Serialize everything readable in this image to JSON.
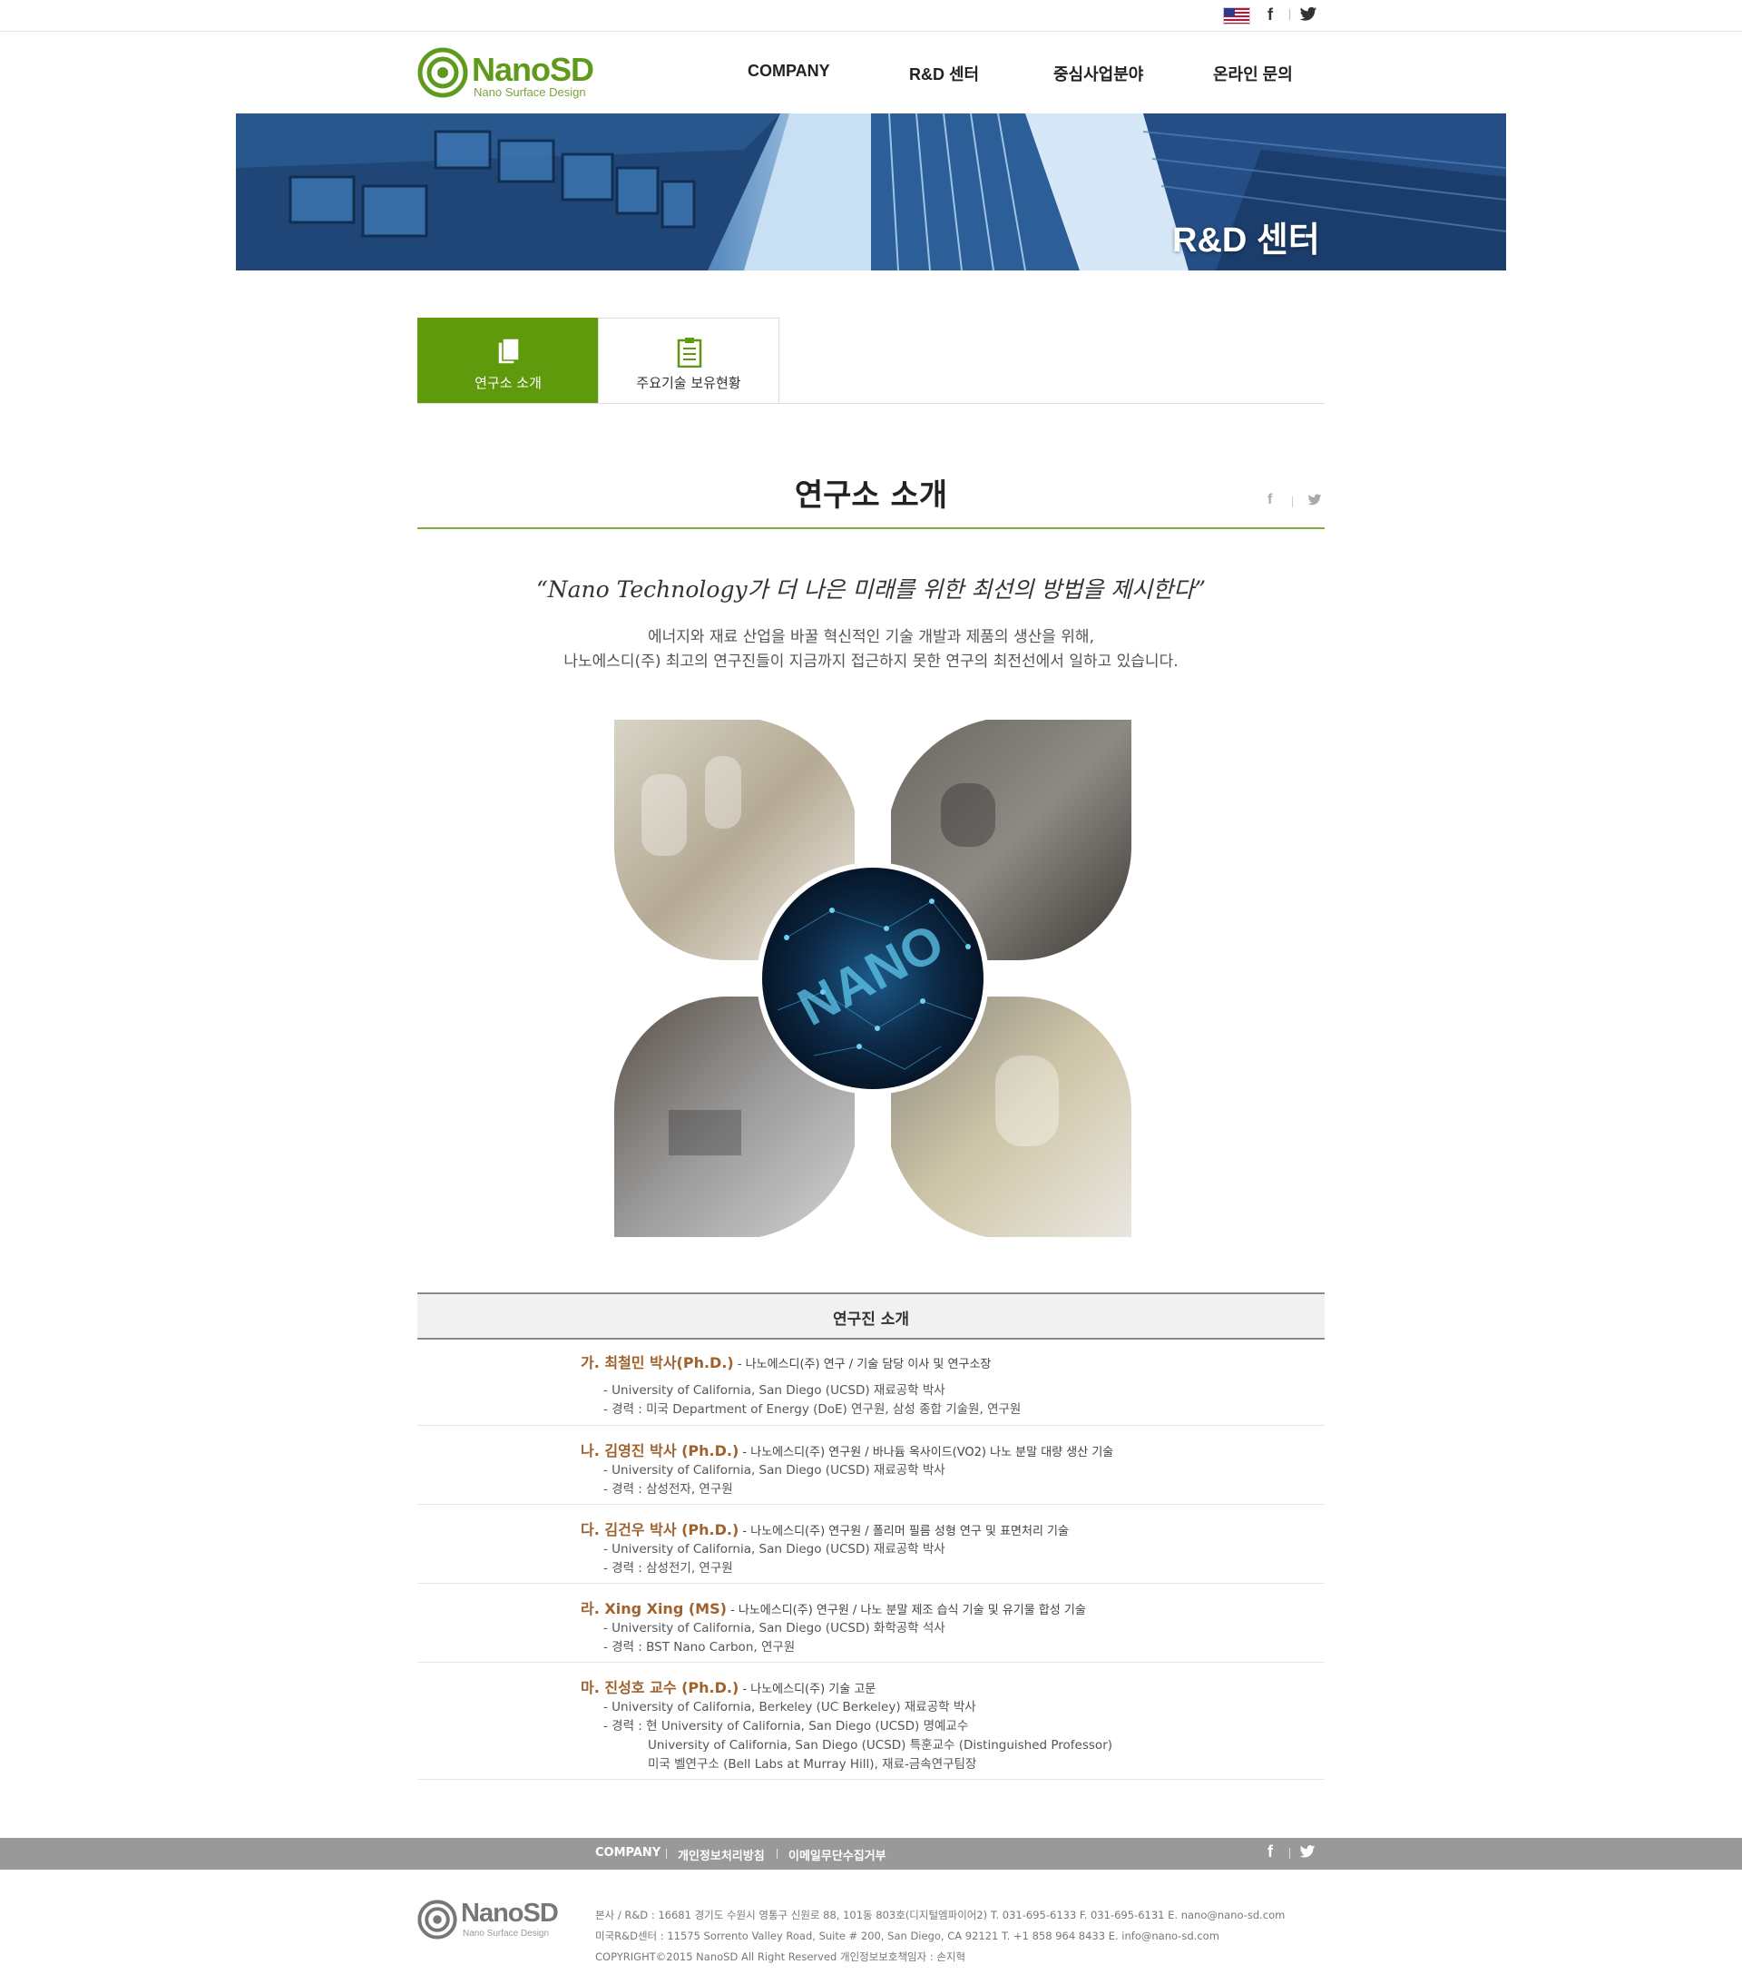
{
  "topbar": {
    "lang_icon": "us-flag-icon",
    "social": [
      "facebook-icon",
      "twitter-icon"
    ],
    "facebook_glyph": "f"
  },
  "header": {
    "logo_name": "NanoSD",
    "logo_sub": "Nano Surface Design",
    "nav": [
      "COMPANY",
      "R&D 센터",
      "중심사업분야",
      "온라인 문의"
    ]
  },
  "hero": {
    "title": "R&D 센터"
  },
  "tabs": [
    {
      "label": "연구소 소개",
      "icon": "documents-icon",
      "active": true
    },
    {
      "label": "주요기술 보유현황",
      "icon": "clipboard-icon",
      "active": false
    }
  ],
  "section": {
    "title": "연구소 소개",
    "share_facebook": "f",
    "quote": "“Nano Technology가 더 나은 미래를 위한 최선의 방법을 제시한다”",
    "intro": [
      "에너지와 재료 산업을 바꿀 혁신적인 기술 개발과 제품의 생산을 위해,",
      "나노에스디(주) 최고의 연구진들이 지금까지 접근하지 못한 연구의 최전선에서 일하고 있습니다."
    ],
    "clover_text": "NANO",
    "colors": {
      "accent": "#5f9a0c",
      "accent_line": "#7fb03a",
      "name": "#a0622d",
      "footer_bar": "#999999"
    }
  },
  "researchers": {
    "heading": "연구진 소개",
    "people": [
      {
        "name": "가. 최철민 박사(Ph.D.)",
        "role": " - 나노에스디(주) 연구 / 기술 담당 이사 및 연구소장",
        "lines": [
          {
            "text": "- University of California, San Diego (UCSD) 재료공학 박사",
            "indent": false
          },
          {
            "text": "- 경력 : 미국 Department of Energy (DoE) 연구원, 삼성 종합 기술원, 연구원",
            "indent": false
          }
        ]
      },
      {
        "name": "나. 김영진 박사 (Ph.D.)",
        "role": " - 나노에스디(주) 연구원 / 바나듐 옥사이드(VO2) 나노 분말 대량 생산 기술",
        "lines": [
          {
            "text": "- University of California, San Diego (UCSD) 재료공학 박사",
            "indent": false
          },
          {
            "text": "- 경력 : 삼성전자, 연구원",
            "indent": false
          }
        ]
      },
      {
        "name": "다. 김건우 박사 (Ph.D.)",
        "role": " - 나노에스디(주) 연구원 / 폴리머 필름 성형 연구 및 표면처리 기술",
        "lines": [
          {
            "text": "- University of California, San Diego (UCSD) 재료공학 박사",
            "indent": false
          },
          {
            "text": "- 경력 : 삼성전기, 연구원",
            "indent": false
          }
        ]
      },
      {
        "name": "라. Xing Xing (MS)",
        "role": " - 나노에스디(주) 연구원 / 나노 분말 제조 습식 기술 및 유기물 합성 기술",
        "lines": [
          {
            "text": "- University of California, San Diego (UCSD) 화학공학 석사",
            "indent": false
          },
          {
            "text": "- 경력 : BST Nano Carbon, 연구원",
            "indent": false
          }
        ]
      },
      {
        "name": "마. 진성호 교수 (Ph.D.)",
        "role": " - 나노에스디(주) 기술 고문",
        "lines": [
          {
            "text": "- University of California, Berkeley (UC Berkeley) 재료공학 박사",
            "indent": false
          },
          {
            "text": "- 경력 : 현 University of California, San Diego (UCSD) 명예교수",
            "indent": false
          },
          {
            "text": "University of California, San Diego (UCSD) 특훈교수 (Distinguished Professor)",
            "indent": true
          },
          {
            "text": "미국 벨연구소 (Bell Labs at Murray Hill), 재료-금속연구팀장",
            "indent": true
          }
        ]
      }
    ]
  },
  "footer": {
    "menu": [
      "COMPANY",
      "개인정보처리방침",
      "이메일무단수집거부"
    ],
    "facebook_glyph": "f",
    "logo_name": "NanoSD",
    "logo_sub": "Nano Surface Design",
    "info": [
      "본사 / R&D : 16681 경기도 수원시 영통구 신원로 88, 101동 803호(디지털엠파이어2)    T. 031-695-6133   F. 031-695-6131    E. nano@nano-sd.com",
      "미국R&D센터 : 11575 Sorrento Valley Road, Suite # 200, San Diego, CA 92121    T. +1 858 964 8433    E. info@nano-sd.com",
      "COPYRIGHT©2015 NanoSD All Right Reserved          개인정보보호책임자 : 손지혁"
    ]
  }
}
